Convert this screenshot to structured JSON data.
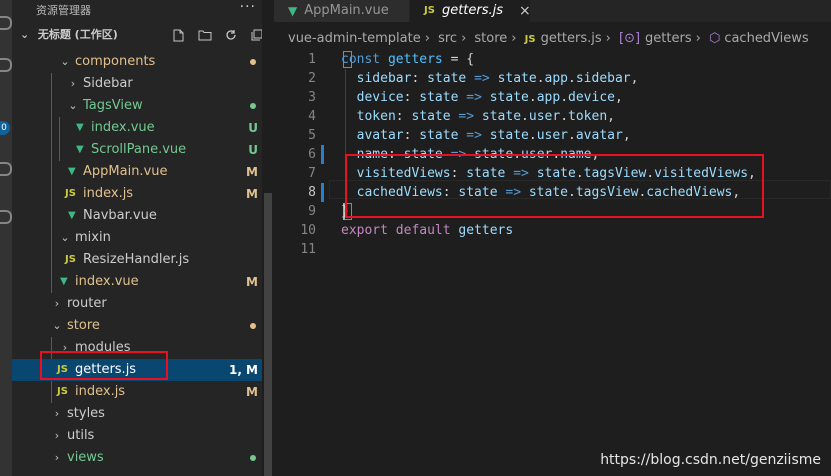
{
  "explorer": {
    "title": "资源管理器",
    "more": "···",
    "workspace": "无标题 (工作区)",
    "tree": [
      {
        "label": "components",
        "type": "folder",
        "state": "open",
        "color": "mod"
      },
      {
        "label": "Sidebar",
        "type": "folder",
        "state": "closed",
        "color": "plain"
      },
      {
        "label": "TagsView",
        "type": "folder",
        "state": "open",
        "color": "green"
      },
      {
        "label": "index.vue",
        "type": "vue",
        "badge": "U",
        "color": "green"
      },
      {
        "label": "ScrollPane.vue",
        "type": "vue",
        "badge": "U",
        "color": "green"
      },
      {
        "label": "AppMain.vue",
        "type": "vue",
        "badge": "M",
        "color": "mod"
      },
      {
        "label": "index.js",
        "type": "js",
        "badge": "M",
        "color": "mod"
      },
      {
        "label": "Navbar.vue",
        "type": "vue",
        "badge": "",
        "color": "plain"
      },
      {
        "label": "mixin",
        "type": "folder",
        "state": "open",
        "color": "plain"
      },
      {
        "label": "ResizeHandler.js",
        "type": "js",
        "badge": "",
        "color": "plain"
      },
      {
        "label": "index.vue",
        "type": "vue",
        "badge": "M",
        "color": "mod"
      },
      {
        "label": "router",
        "type": "folder",
        "state": "closed",
        "color": "plain"
      },
      {
        "label": "store",
        "type": "folder",
        "state": "open",
        "color": "mod"
      },
      {
        "label": "modules",
        "type": "folder",
        "state": "closed",
        "color": "plain"
      },
      {
        "label": "getters.js",
        "type": "js",
        "badge": "1, M",
        "color": "mod"
      },
      {
        "label": "index.js",
        "type": "js",
        "badge": "M",
        "color": "mod"
      },
      {
        "label": "styles",
        "type": "folder",
        "state": "closed",
        "color": "plain"
      },
      {
        "label": "utils",
        "type": "folder",
        "state": "closed",
        "color": "plain"
      },
      {
        "label": "views",
        "type": "folder",
        "state": "closed",
        "color": "green"
      }
    ]
  },
  "tabs": [
    {
      "label": "AppMain.vue",
      "icon": "vue-icon",
      "active": false
    },
    {
      "label": "getters.js",
      "icon": "js-icon",
      "active": true,
      "close": "×"
    }
  ],
  "breadcrumb": [
    "vue-admin-template",
    "src",
    "store",
    "getters.js",
    "getters",
    "cachedViews"
  ],
  "code": {
    "line_numbers": [
      "1",
      "2",
      "3",
      "4",
      "5",
      "6",
      "7",
      "8",
      "9",
      "10",
      "11"
    ],
    "lines": [
      [
        [
          "kw",
          "const "
        ],
        [
          "var",
          "getters"
        ],
        [
          "op",
          " = {"
        ]
      ],
      [
        [
          "op",
          "  "
        ],
        [
          "prop",
          "sidebar"
        ],
        [
          "op",
          ": "
        ],
        [
          "prop",
          "state"
        ],
        [
          "kw",
          " => "
        ],
        [
          "prop",
          "state"
        ],
        [
          "op",
          "."
        ],
        [
          "prop",
          "app"
        ],
        [
          "op",
          "."
        ],
        [
          "prop",
          "sidebar"
        ],
        [
          "op",
          ","
        ]
      ],
      [
        [
          "op",
          "  "
        ],
        [
          "prop",
          "device"
        ],
        [
          "op",
          ": "
        ],
        [
          "prop",
          "state"
        ],
        [
          "kw",
          " => "
        ],
        [
          "prop",
          "state"
        ],
        [
          "op",
          "."
        ],
        [
          "prop",
          "app"
        ],
        [
          "op",
          "."
        ],
        [
          "prop",
          "device"
        ],
        [
          "op",
          ","
        ]
      ],
      [
        [
          "op",
          "  "
        ],
        [
          "prop",
          "token"
        ],
        [
          "op",
          ": "
        ],
        [
          "prop",
          "state"
        ],
        [
          "kw",
          " => "
        ],
        [
          "prop",
          "state"
        ],
        [
          "op",
          "."
        ],
        [
          "prop",
          "user"
        ],
        [
          "op",
          "."
        ],
        [
          "prop",
          "token"
        ],
        [
          "op",
          ","
        ]
      ],
      [
        [
          "op",
          "  "
        ],
        [
          "prop",
          "avatar"
        ],
        [
          "op",
          ": "
        ],
        [
          "prop",
          "state"
        ],
        [
          "kw",
          " => "
        ],
        [
          "prop",
          "state"
        ],
        [
          "op",
          "."
        ],
        [
          "prop",
          "user"
        ],
        [
          "op",
          "."
        ],
        [
          "prop",
          "avatar"
        ],
        [
          "op",
          ","
        ]
      ],
      [
        [
          "op",
          "  "
        ],
        [
          "prop",
          "name"
        ],
        [
          "op",
          ": "
        ],
        [
          "prop",
          "state"
        ],
        [
          "kw",
          " => "
        ],
        [
          "prop",
          "state"
        ],
        [
          "op",
          "."
        ],
        [
          "prop",
          "user"
        ],
        [
          "op",
          "."
        ],
        [
          "prop",
          "name"
        ],
        [
          "op",
          ","
        ]
      ],
      [
        [
          "op",
          "  "
        ],
        [
          "prop",
          "visitedViews"
        ],
        [
          "op",
          ": "
        ],
        [
          "prop",
          "state"
        ],
        [
          "kw",
          " => "
        ],
        [
          "prop",
          "state"
        ],
        [
          "op",
          "."
        ],
        [
          "prop",
          "tagsView"
        ],
        [
          "op",
          "."
        ],
        [
          "prop",
          "visitedViews"
        ],
        [
          "op",
          ","
        ]
      ],
      [
        [
          "op",
          "  "
        ],
        [
          "prop",
          "cachedViews"
        ],
        [
          "op",
          ": "
        ],
        [
          "prop",
          "state"
        ],
        [
          "kw",
          " => "
        ],
        [
          "prop",
          "state"
        ],
        [
          "op",
          "."
        ],
        [
          "prop",
          "tagsView"
        ],
        [
          "op",
          "."
        ],
        [
          "prop",
          "cachedViews"
        ],
        [
          "op",
          ","
        ]
      ],
      [
        [
          "op",
          "}"
        ]
      ],
      [
        [
          "kw2",
          "export"
        ],
        [
          "op",
          " "
        ],
        [
          "kw2",
          "default"
        ],
        [
          "op",
          " "
        ],
        [
          "prop",
          "getters"
        ]
      ],
      []
    ]
  },
  "watermark": "https://blog.csdn.net/genziisme",
  "colors": {
    "accent": "#094771",
    "highlight_box": "#e81123",
    "modified": "#e2c08d",
    "untracked": "#73c991"
  }
}
